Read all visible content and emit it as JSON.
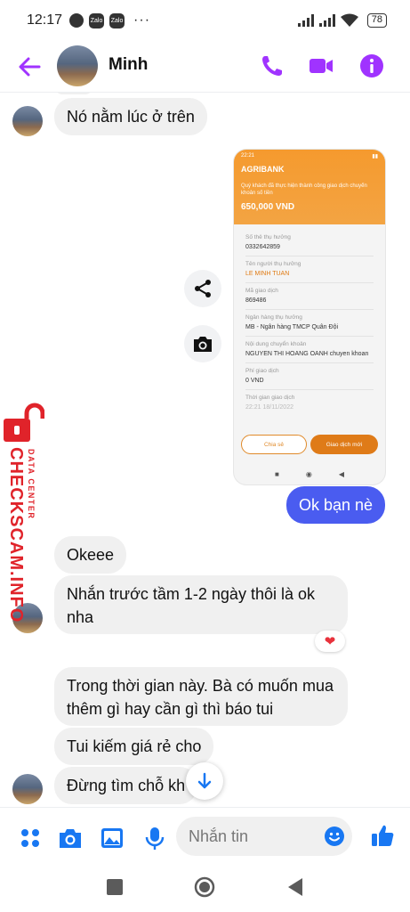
{
  "status_bar": {
    "time": "12:17",
    "app_icon_1": "Zalo",
    "app_icon_2": "Zalo",
    "dots": "···",
    "battery": "78"
  },
  "header": {
    "contact_name": "Minh"
  },
  "messages": {
    "m1": "Nó nằm lúc ở trên",
    "m2": "Ok bạn nè",
    "m3": "Okeee",
    "m4": "Nhắn trước tầm 1-2 ngày thôi là ok nha",
    "m5": "Trong thời gian này. Bà có muốn mua thêm gì hay cần gì thì báo tui",
    "m6": "Tui kiếm giá rẻ cho",
    "m7": "Đừng tìm chỗ kh"
  },
  "receipt": {
    "time": "22:21",
    "brand": "AGRIBANK",
    "message": "Quý khách đã thực hiện thành công giao dịch chuyển khoản số tiền",
    "amount": "650,000 VND",
    "rows": [
      {
        "label": "Số thẻ thụ hưởng",
        "value": "0332642859"
      },
      {
        "label": "Tên người thụ hưởng",
        "value": "LE MINH TUAN"
      },
      {
        "label": "Mã giao dịch",
        "value": "869486"
      },
      {
        "label": "Ngân hàng thụ hưởng",
        "value": "MB - Ngân hàng TMCP Quân Đội"
      },
      {
        "label": "Nội dung chuyển khoản",
        "value": "NGUYEN THI HOANG OANH chuyen khoan"
      },
      {
        "label": "Phí giao dịch",
        "value": "0 VND"
      },
      {
        "label": "Thời gian giao dịch",
        "value": "22:21 18/11/2022"
      }
    ],
    "share_button": "Chia sẻ",
    "new_transaction_button": "Giao dịch mới"
  },
  "watermark": {
    "main": "CHECKSCAM.INFO",
    "sub": "DATA CENTER"
  },
  "reaction": "❤",
  "composer": {
    "placeholder": "Nhắn tin"
  },
  "colors": {
    "accent": "#a033ff",
    "outgoing_bubble": "#4a5cf0",
    "icon_blue": "#1877f2",
    "watermark_red": "#e0232a",
    "receipt_orange": "#f59a2e"
  }
}
